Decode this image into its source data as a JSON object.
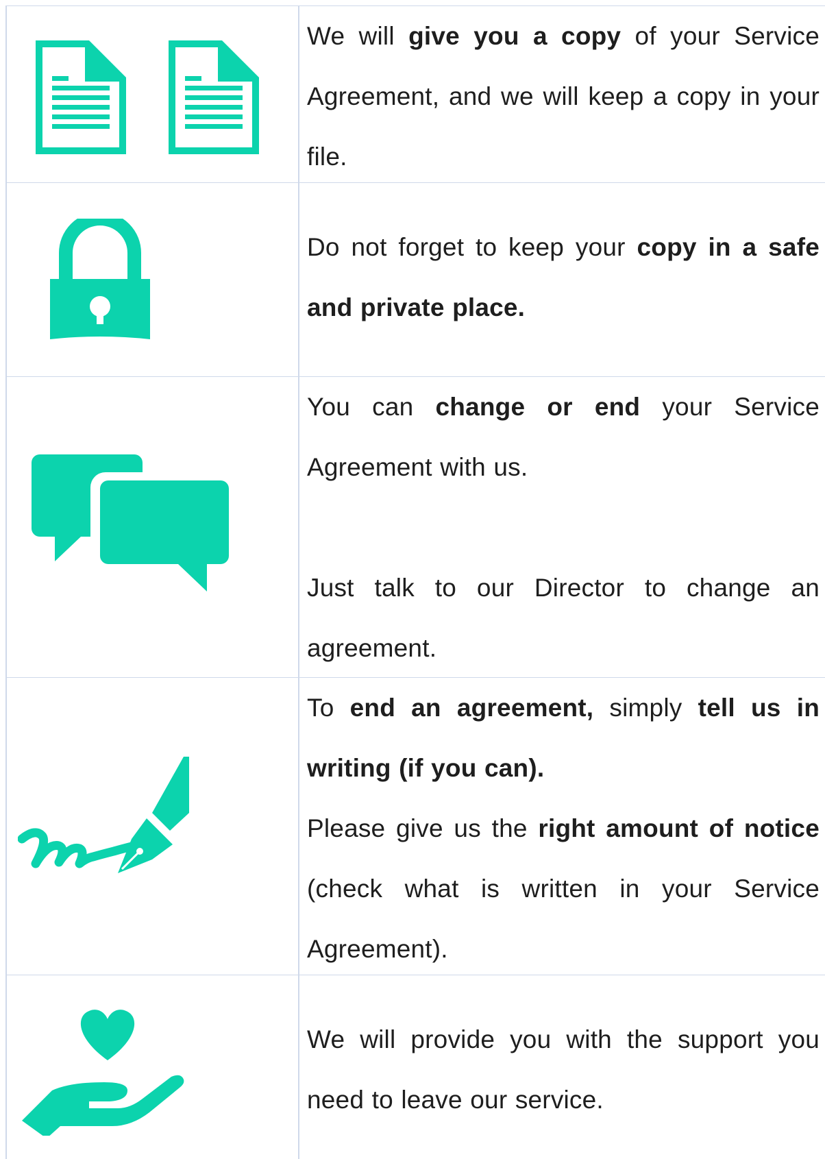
{
  "accent_color": "#0cd3ad",
  "rows": [
    {
      "icon": "documents-icon",
      "paragraphs": [
        [
          {
            "text": "We will ",
            "bold": false
          },
          {
            "text": "give you a copy",
            "bold": true
          },
          {
            "text": " of your Service Agreement, and we will keep a copy in your file.",
            "bold": false
          }
        ]
      ]
    },
    {
      "icon": "padlock-icon",
      "paragraphs": [
        [
          {
            "text": "Do not forget to keep your ",
            "bold": false
          },
          {
            "text": "copy in a safe and private place.",
            "bold": true
          }
        ]
      ]
    },
    {
      "icon": "speech-bubbles-icon",
      "paragraphs": [
        [
          {
            "text": "You can ",
            "bold": false
          },
          {
            "text": "change or end",
            "bold": true
          },
          {
            "text": " your Service Agreement with us.",
            "bold": false
          }
        ],
        [
          {
            "text": "Just talk to our Director to change an agreement.",
            "bold": false
          }
        ]
      ]
    },
    {
      "icon": "pen-signature-icon",
      "paragraphs": [
        [
          {
            "text": "To ",
            "bold": false
          },
          {
            "text": "end an agreement,",
            "bold": true
          },
          {
            "text": " simply ",
            "bold": false
          },
          {
            "text": "tell us in writing (if you can).",
            "bold": true
          }
        ],
        [
          {
            "text": "Please give us the ",
            "bold": false
          },
          {
            "text": "right amount of notice",
            "bold": true
          },
          {
            "text": " (check what is written in your Service Agreement).",
            "bold": false
          }
        ]
      ]
    },
    {
      "icon": "heart-in-hand-icon",
      "paragraphs": [
        [
          {
            "text": "We will provide you with the support you need to leave our service.",
            "bold": false
          }
        ]
      ]
    }
  ]
}
